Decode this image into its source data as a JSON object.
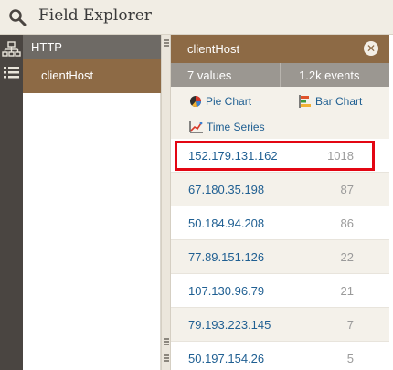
{
  "header": {
    "title": "Field Explorer",
    "icon": "search-icon"
  },
  "rail": {
    "icons": [
      "hierarchy-icon",
      "list-icon"
    ]
  },
  "categories": {
    "group": "HTTP",
    "selected": "clientHost"
  },
  "panel": {
    "title": "clientHost",
    "close_icon": "close-icon",
    "values_count": "7 values",
    "events_count": "1.2k events",
    "links": {
      "pie": "Pie Chart",
      "bar": "Bar Chart",
      "time_series": "Time Series"
    },
    "rows": [
      {
        "ip": "152.179.131.162",
        "count": "1018"
      },
      {
        "ip": "67.180.35.198",
        "count": "87"
      },
      {
        "ip": "50.184.94.208",
        "count": "86"
      },
      {
        "ip": "77.89.151.126",
        "count": "22"
      },
      {
        "ip": "107.130.96.79",
        "count": "21"
      },
      {
        "ip": "79.193.223.145",
        "count": "7"
      },
      {
        "ip": "50.197.154.26",
        "count": "5"
      }
    ]
  },
  "colors": {
    "accent_brown": "#8d6a45",
    "link_blue": "#1f5f92",
    "highlight_red": "#e30613"
  }
}
